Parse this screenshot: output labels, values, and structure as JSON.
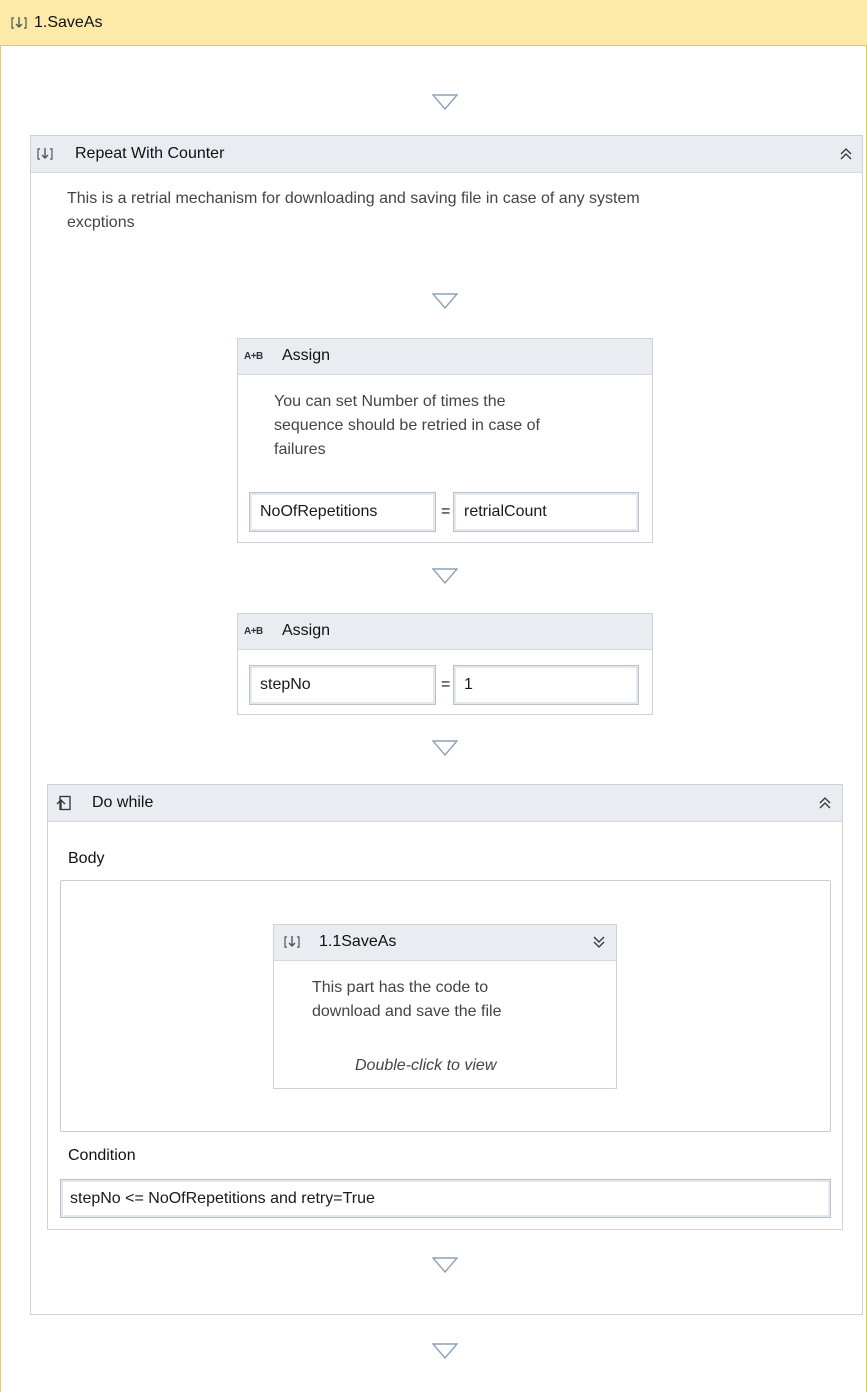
{
  "outer": {
    "title": "1.SaveAs"
  },
  "repeat": {
    "title": "Repeat With Counter",
    "description_line1": "This is a retrial mechanism for downloading and saving file in case of any system",
    "description_line2": "excptions",
    "collapse_glyph": "≪"
  },
  "assign1": {
    "icon_text": "A+B",
    "title": "Assign",
    "description_line1": "You can set Number of times the",
    "description_line2": "sequence should be retried in case of",
    "description_line3": "failures",
    "left_value": "NoOfRepetitions",
    "equals": "=",
    "right_value": "retrialCount"
  },
  "assign2": {
    "icon_text": "A+B",
    "title": "Assign",
    "left_value": "stepNo",
    "equals": "=",
    "right_value": "1"
  },
  "dowhile": {
    "title": "Do while",
    "body_label": "Body",
    "condition_label": "Condition",
    "condition_value": "stepNo <= NoOfRepetitions and retry=True"
  },
  "inner_seq": {
    "title": "1.1SaveAs",
    "description_line1": "This part has the code to",
    "description_line2": "download and save the file",
    "hint": "Double-click to view"
  },
  "colors": {
    "header_yellow": "#fde9a8",
    "card_header": "#e9ecf0",
    "border": "#cfd3d8"
  },
  "icons": [
    "sequence-icon",
    "assign-icon",
    "do-while-icon",
    "collapse-icon",
    "expand-icon",
    "drop-target-icon"
  ]
}
